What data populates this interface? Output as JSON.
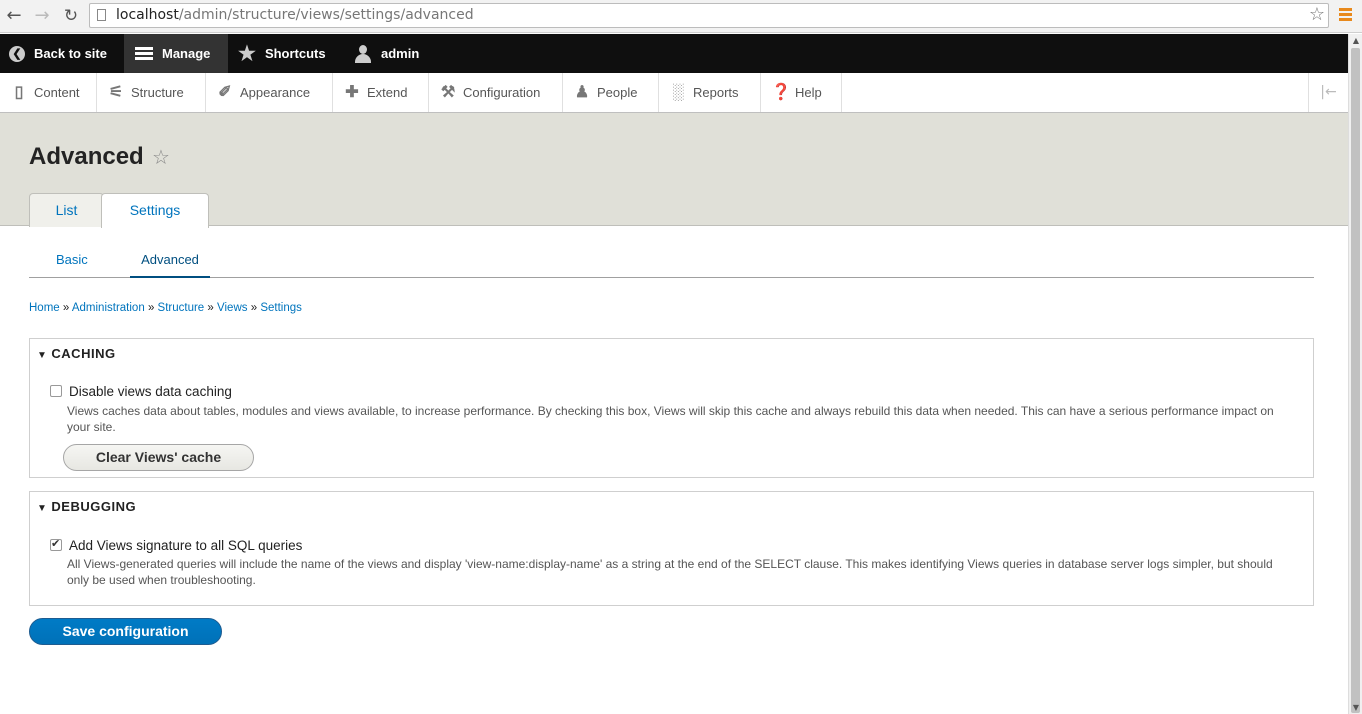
{
  "browser": {
    "url_host": "localhost",
    "url_path": "/admin/structure/views/settings/advanced",
    "icons": [
      "back-arrow-icon",
      "forward-arrow-icon",
      "reload-icon",
      "bookmark-star-icon",
      "browser-menu-icon"
    ]
  },
  "toolbar": {
    "back_label": "Back to site",
    "manage_label": "Manage",
    "shortcuts_label": "Shortcuts",
    "user_label": "admin"
  },
  "admin_menu": {
    "items": [
      {
        "label": "Content",
        "icon": "document-icon"
      },
      {
        "label": "Structure",
        "icon": "structure-icon"
      },
      {
        "label": "Appearance",
        "icon": "brush-icon"
      },
      {
        "label": "Extend",
        "icon": "puzzle-icon"
      },
      {
        "label": "Configuration",
        "icon": "wrench-icon"
      },
      {
        "label": "People",
        "icon": "people-icon"
      },
      {
        "label": "Reports",
        "icon": "bar-chart-icon"
      },
      {
        "label": "Help",
        "icon": "help-icon"
      }
    ]
  },
  "page": {
    "title": "Advanced",
    "primary_tabs": [
      "List",
      "Settings"
    ],
    "active_primary_tab": "Settings",
    "secondary_tabs": [
      "Basic",
      "Advanced"
    ],
    "active_secondary_tab": "Advanced"
  },
  "breadcrumb": {
    "items": [
      "Home",
      "Administration",
      "Structure",
      "Views",
      "Settings"
    ],
    "separator": "»"
  },
  "caching": {
    "legend": "CACHING",
    "checkbox_label": "Disable views data caching",
    "checked": false,
    "description": "Views caches data about tables, modules and views available, to increase performance. By checking this box, Views will skip this cache and always rebuild this data when needed. This can have a serious performance impact on your site.",
    "button_label": "Clear Views' cache"
  },
  "debugging": {
    "legend": "DEBUGGING",
    "checkbox_label": "Add Views signature to all SQL queries",
    "checked": true,
    "description": "All Views-generated queries will include the name of the views and display 'view-name:display-name' as a string at the end of the SELECT clause. This makes identifying Views queries in database server logs simpler, but should only be used when troubleshooting."
  },
  "actions": {
    "save_label": "Save configuration"
  },
  "colors": {
    "toolbar_bg": "#0f0f0f",
    "link": "#0074bd",
    "primary_button": "#0074bd",
    "header_bg": "#e0e0d8"
  }
}
